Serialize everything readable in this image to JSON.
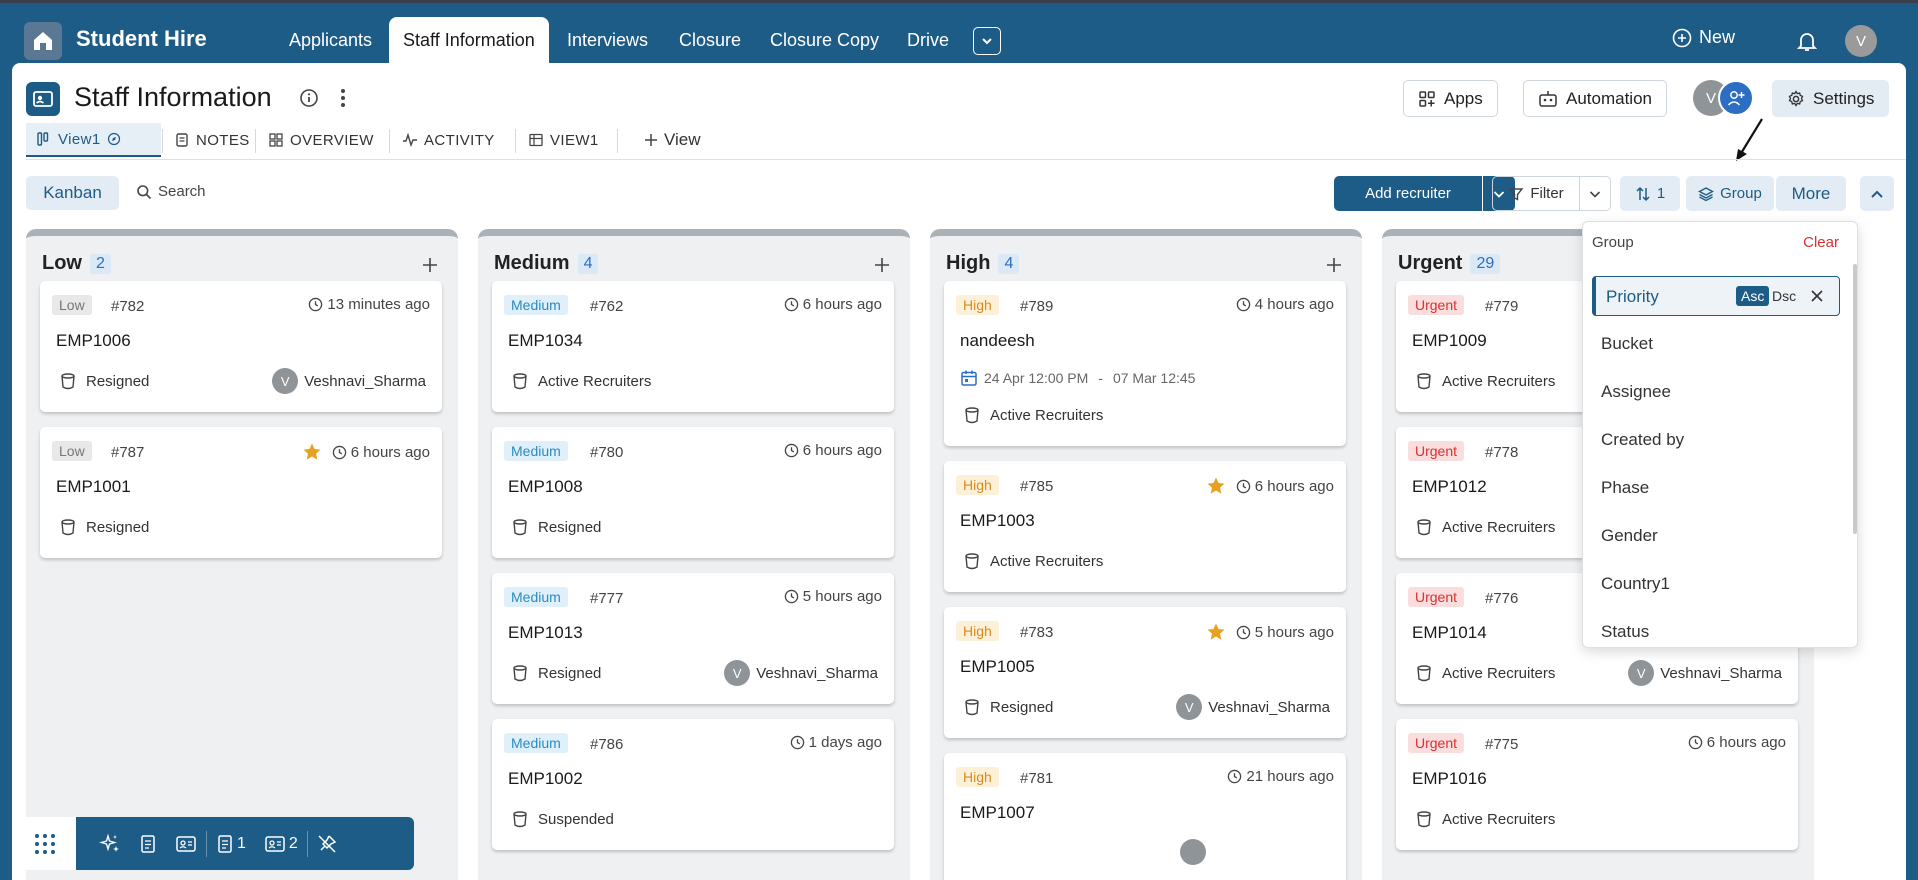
{
  "app": {
    "name": "Student Hire"
  },
  "nav": {
    "tabs": [
      {
        "label": "Applicants"
      },
      {
        "label": "Staff Information"
      },
      {
        "label": "Interviews"
      },
      {
        "label": "Closure"
      },
      {
        "label": "Closure Copy"
      },
      {
        "label": "Drive"
      }
    ],
    "active": "Staff Information",
    "new_label": "New",
    "user_initial": "V"
  },
  "page": {
    "title": "Staff Information",
    "apps_label": "Apps",
    "automation_label": "Automation",
    "settings_label": "Settings",
    "member_initial": "V"
  },
  "views": {
    "tabs": [
      {
        "label": "View1"
      },
      {
        "label": "NOTES"
      },
      {
        "label": "OVERVIEW"
      },
      {
        "label": "ACTIVITY"
      },
      {
        "label": "VIEW1"
      },
      {
        "label": "View"
      }
    ]
  },
  "toolbar": {
    "kanban_label": "Kanban",
    "search_label": "Search",
    "add_recruiter_label": "Add recruiter",
    "filter_label": "Filter",
    "sort_count": "1",
    "group_label": "Group",
    "more_label": "More"
  },
  "columns": [
    {
      "name": "Low",
      "count": "2",
      "cards": [
        {
          "priority": "Low",
          "id": "#782",
          "time": "13 minutes ago",
          "name": "EMP1006",
          "bucket": "Resigned",
          "assignee": "Veshnavi_Sharma",
          "initial": "V"
        },
        {
          "priority": "Low",
          "id": "#787",
          "time": "6 hours ago",
          "name": "EMP1001",
          "bucket": "Resigned"
        }
      ]
    },
    {
      "name": "Medium",
      "count": "4",
      "cards": [
        {
          "priority": "Medium",
          "id": "#762",
          "time": "6 hours ago",
          "name": "EMP1034",
          "bucket": "Active Recruiters"
        },
        {
          "priority": "Medium",
          "id": "#780",
          "time": "6 hours ago",
          "name": "EMP1008",
          "bucket": "Resigned"
        },
        {
          "priority": "Medium",
          "id": "#777",
          "time": "5 hours ago",
          "name": "EMP1013",
          "bucket": "Resigned",
          "assignee": "Veshnavi_Sharma",
          "initial": "V"
        },
        {
          "priority": "Medium",
          "id": "#786",
          "time": "1 days ago",
          "name": "EMP1002",
          "bucket": "Suspended"
        }
      ]
    },
    {
      "name": "High",
      "count": "4",
      "cards": [
        {
          "priority": "High",
          "id": "#789",
          "time": "4 hours ago",
          "name": "nandeesh",
          "date_start": "24 Apr 12:00 PM",
          "date_sep": "-",
          "date_end": "07 Mar 12:45",
          "bucket": "Active Recruiters"
        },
        {
          "priority": "High",
          "id": "#785",
          "time": "6 hours ago",
          "name": "EMP1003",
          "bucket": "Active Recruiters"
        },
        {
          "priority": "High",
          "id": "#783",
          "time": "5 hours ago",
          "name": "EMP1005",
          "bucket": "Resigned",
          "assignee": "Veshnavi_Sharma",
          "initial": "V"
        },
        {
          "priority": "High",
          "id": "#781",
          "time": "21 hours ago",
          "name": "EMP1007"
        }
      ]
    },
    {
      "name": "Urgent",
      "count": "29",
      "cards": [
        {
          "priority": "Urgent",
          "id": "#779",
          "name": "EMP1009",
          "bucket": "Active Recruiters"
        },
        {
          "priority": "Urgent",
          "id": "#778",
          "name": "EMP1012",
          "bucket": "Active Recruiters"
        },
        {
          "priority": "Urgent",
          "id": "#776",
          "name": "EMP1014",
          "bucket": "Active Recruiters",
          "assignee": "Veshnavi_Sharma",
          "initial": "V"
        },
        {
          "priority": "Urgent",
          "id": "#775",
          "time": "6 hours ago",
          "name": "EMP1016",
          "bucket": "Active Recruiters"
        }
      ]
    }
  ],
  "group_dropdown": {
    "title": "Group",
    "clear_label": "Clear",
    "selected": "Priority",
    "asc_label": "Asc",
    "dsc_label": "Dsc",
    "options": [
      "Bucket",
      "Assignee",
      "Created by",
      "Phase",
      "Gender",
      "Country1",
      "Status"
    ]
  },
  "dock": {
    "doc_count": "1",
    "card_count": "2"
  }
}
